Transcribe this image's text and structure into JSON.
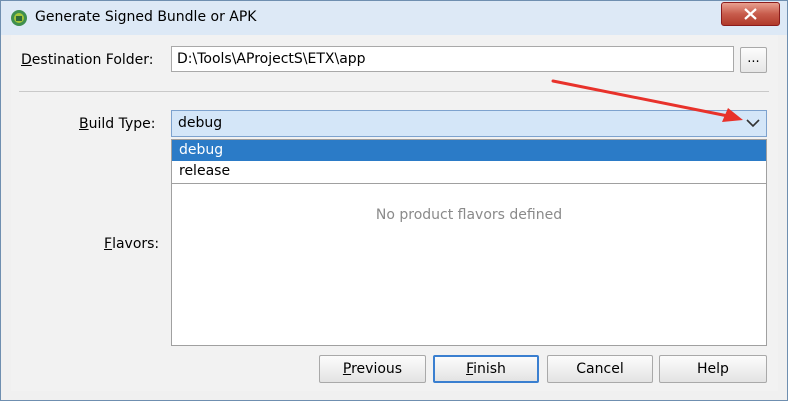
{
  "window": {
    "title": "Generate Signed Bundle or APK"
  },
  "destination": {
    "label_mnemonic": "D",
    "label_rest": "estination Folder:",
    "value": "D:\\Tools\\AProjectS\\ETX\\app",
    "browse_label": "..."
  },
  "build_type": {
    "label_mnemonic": "B",
    "label_rest": "uild Type:",
    "selected": "debug",
    "options": [
      "debug",
      "release"
    ]
  },
  "flavors": {
    "label_mnemonic": "F",
    "label_rest": "lavors:",
    "empty_message": "No product flavors defined"
  },
  "buttons": {
    "previous": {
      "mnemonic": "P",
      "rest": "revious"
    },
    "finish": {
      "mnemonic": "F",
      "rest": "inish"
    },
    "cancel": "Cancel",
    "help": "Help"
  },
  "colors": {
    "selection": "#2b7bc7",
    "combo_bg": "#d4e6f8",
    "annotation_arrow": "#e8322b"
  }
}
